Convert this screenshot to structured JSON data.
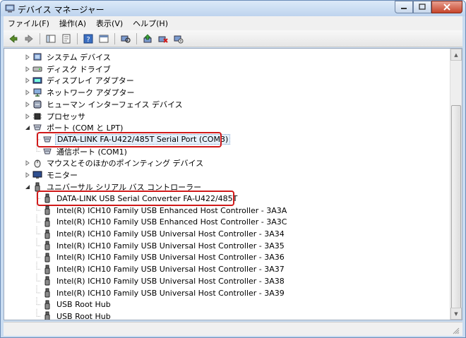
{
  "window": {
    "title": "デバイス マネージャー"
  },
  "menu": [
    {
      "label": "ファイル(F)"
    },
    {
      "label": "操作(A)"
    },
    {
      "label": "表示(V)"
    },
    {
      "label": "ヘルプ(H)"
    }
  ],
  "toolbar": [
    {
      "icon": "back-arrow-icon"
    },
    {
      "icon": "forward-arrow-icon"
    },
    {
      "icon": "properties-icon"
    },
    {
      "icon": "help-icon"
    },
    {
      "icon": "scan-hardware-icon"
    },
    {
      "icon": "update-driver-icon"
    },
    {
      "icon": "disable-device-icon"
    },
    {
      "icon": "uninstall-device-icon"
    }
  ],
  "tree": [
    {
      "label": "システム デバイス",
      "icon": "system-device-icon",
      "expander": "collapsed"
    },
    {
      "label": "ディスク ドライブ",
      "icon": "disk-drive-icon",
      "expander": "collapsed"
    },
    {
      "label": "ディスプレイ アダプター",
      "icon": "display-adapter-icon",
      "expander": "collapsed"
    },
    {
      "label": "ネットワーク アダプター",
      "icon": "network-adapter-icon",
      "expander": "collapsed"
    },
    {
      "label": "ヒューマン インターフェイス デバイス",
      "icon": "hid-icon",
      "expander": "collapsed"
    },
    {
      "label": "プロセッサ",
      "icon": "processor-icon",
      "expander": "collapsed"
    },
    {
      "label": "ポート (COM と LPT)",
      "icon": "port-icon",
      "expander": "expanded"
    },
    {
      "label": "DATA-LINK FA-U422/485T Serial Port (COM3)",
      "icon": "port-icon",
      "expander": "none",
      "child": true,
      "selected": true,
      "highlighted": true
    },
    {
      "label": "通信ポート (COM1)",
      "icon": "port-icon",
      "expander": "none",
      "child": true
    },
    {
      "label": "マウスとそのほかのポインティング デバイス",
      "icon": "mouse-icon",
      "expander": "collapsed"
    },
    {
      "label": "モニター",
      "icon": "monitor-icon",
      "expander": "collapsed"
    },
    {
      "label": "ユニバーサル シリアル バス コントローラー",
      "icon": "usb-icon",
      "expander": "expanded"
    },
    {
      "label": "DATA-LINK USB Serial Converter FA-U422/485T",
      "icon": "usb-icon",
      "expander": "none",
      "child": true,
      "highlighted": true
    },
    {
      "label": "Intel(R) ICH10 Family USB Enhanced Host Controller - 3A3A",
      "icon": "usb-icon",
      "expander": "none",
      "child": true
    },
    {
      "label": "Intel(R) ICH10 Family USB Enhanced Host Controller - 3A3C",
      "icon": "usb-icon",
      "expander": "none",
      "child": true
    },
    {
      "label": "Intel(R) ICH10 Family USB Universal Host Controller - 3A34",
      "icon": "usb-icon",
      "expander": "none",
      "child": true
    },
    {
      "label": "Intel(R) ICH10 Family USB Universal Host Controller - 3A35",
      "icon": "usb-icon",
      "expander": "none",
      "child": true
    },
    {
      "label": "Intel(R) ICH10 Family USB Universal Host Controller - 3A36",
      "icon": "usb-icon",
      "expander": "none",
      "child": true
    },
    {
      "label": "Intel(R) ICH10 Family USB Universal Host Controller - 3A37",
      "icon": "usb-icon",
      "expander": "none",
      "child": true
    },
    {
      "label": "Intel(R) ICH10 Family USB Universal Host Controller - 3A38",
      "icon": "usb-icon",
      "expander": "none",
      "child": true
    },
    {
      "label": "Intel(R) ICH10 Family USB Universal Host Controller - 3A39",
      "icon": "usb-icon",
      "expander": "none",
      "child": true
    },
    {
      "label": "USB Root Hub",
      "icon": "usb-icon",
      "expander": "none",
      "child": true
    },
    {
      "label": "USB Root Hub",
      "icon": "usb-icon",
      "expander": "none",
      "child": true
    }
  ],
  "colors": {
    "highlight": "#d11a1a",
    "window_frame": "#c9dcf1"
  }
}
